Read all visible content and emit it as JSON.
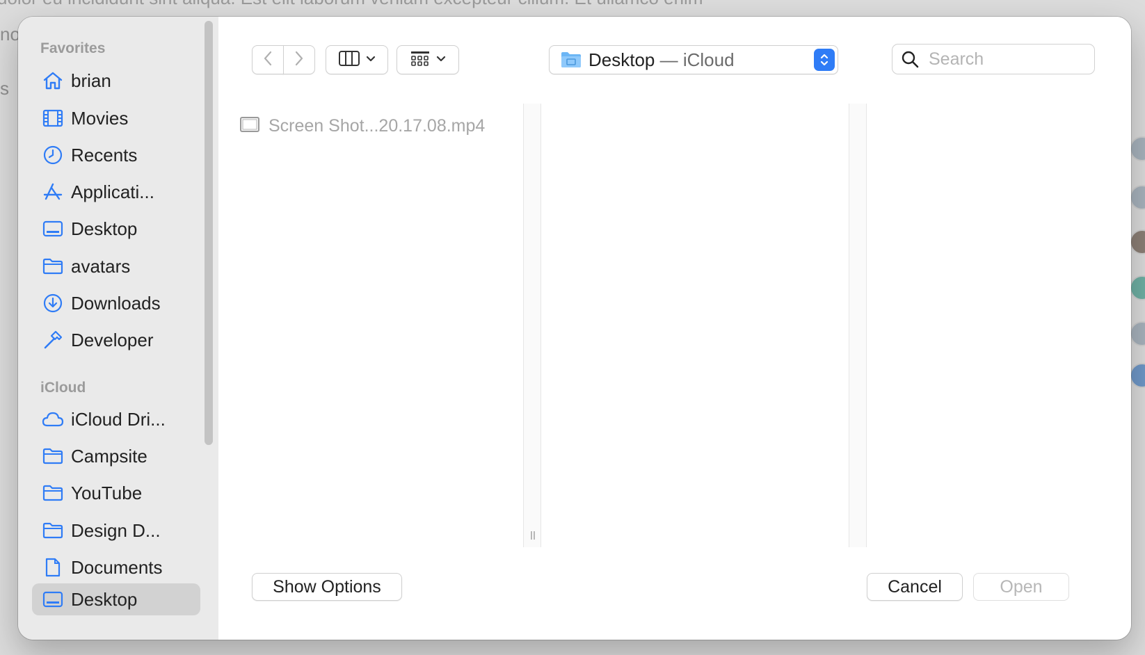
{
  "background": {
    "text": "dolor eu incididunt sint aliqua. Est elit laborum veniam excepteur cillum. Et ullamco enim",
    "left_fragment_1": "no",
    "left_fragment_2": "s"
  },
  "sidebar": {
    "favorites_header": "Favorites",
    "favorites": [
      {
        "label": "brian",
        "icon": "home-icon"
      },
      {
        "label": "Movies",
        "icon": "film-icon"
      },
      {
        "label": "Recents",
        "icon": "clock-icon"
      },
      {
        "label": "Applicati...",
        "icon": "applications-icon"
      },
      {
        "label": "Desktop",
        "icon": "desktop-icon"
      },
      {
        "label": "avatars",
        "icon": "folder-icon"
      },
      {
        "label": "Downloads",
        "icon": "download-icon"
      },
      {
        "label": "Developer",
        "icon": "hammer-icon"
      }
    ],
    "icloud_header": "iCloud",
    "icloud": [
      {
        "label": "iCloud Dri...",
        "icon": "cloud-icon"
      },
      {
        "label": "Campsite",
        "icon": "folder-icon"
      },
      {
        "label": "YouTube",
        "icon": "folder-icon"
      },
      {
        "label": "Design D...",
        "icon": "folder-icon"
      },
      {
        "label": "Documents",
        "icon": "document-icon"
      },
      {
        "label": "Desktop",
        "icon": "desktop-icon",
        "selected": true
      }
    ]
  },
  "toolbar": {
    "path_label": "Desktop",
    "path_sublabel": "— iCloud",
    "search_placeholder": "Search"
  },
  "browser": {
    "files": [
      {
        "name": "Screen Shot...20.17.08.mp4",
        "icon": "video-file-icon",
        "disabled": true
      }
    ]
  },
  "footer": {
    "show_options": "Show Options",
    "cancel": "Cancel",
    "open": "Open"
  },
  "colors": {
    "accent": "#2f7cf6",
    "sidebar_icon": "#2f7cf6",
    "sidebar_bg": "#eaeaea"
  }
}
